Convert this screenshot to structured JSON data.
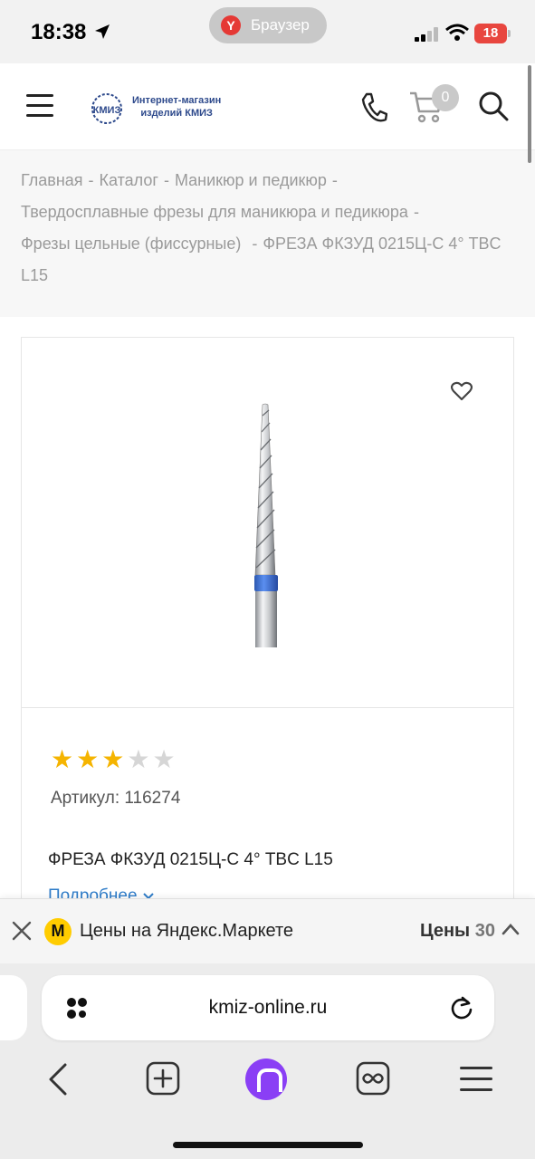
{
  "status_bar": {
    "time": "18:38",
    "browser_pill": "Браузер",
    "browser_pill_logo": "Y",
    "battery": "18"
  },
  "header": {
    "logo_line1": "Интернет-магазин",
    "logo_line2": "изделий КМИЗ",
    "logo_mark": "КМИЗ",
    "cart_count": "0"
  },
  "breadcrumb": {
    "items": [
      "Главная",
      "Каталог",
      "Маникюр и педикюр",
      "Твердосплавные фрезы для маникюра и педикюра",
      "Фрезы цельные (фиссурные)",
      "ФРЕЗА ФКЗУД 0215Ц-С 4° TBC L15"
    ],
    "separator": "-"
  },
  "product": {
    "rating": 3,
    "rating_max": 5,
    "sku_text": "Артикул: 116274",
    "name": "ФРЕЗА ФКЗУД 0215Ц-С 4° TBC L15",
    "more_link": "Подробнее",
    "band_color": "#3b6fd1"
  },
  "market_bar": {
    "text": "Цены на Яндекс.Маркете",
    "prices_label": "Цены",
    "prices_count": "30",
    "logo_letter": "M"
  },
  "browser": {
    "url": "kmiz-online.ru"
  },
  "colors": {
    "accent_link": "#2f7cc8",
    "star_on": "#f5b400",
    "alice": "#8a3ff5",
    "market_logo": "#ffcc00"
  }
}
